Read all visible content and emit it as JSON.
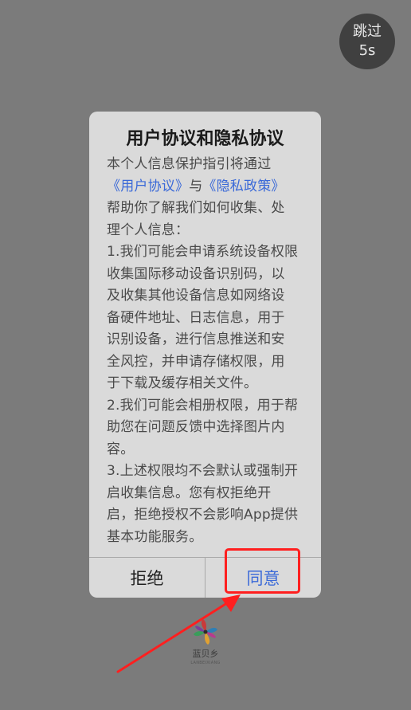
{
  "skip": {
    "label": "跳过",
    "countdown": "5s"
  },
  "dialog": {
    "title": "用户协议和隐私协议",
    "intro_1": "本个人信息保护指引将通过",
    "link_user_agreement": "《用户协议》",
    "connector": "与",
    "link_privacy_policy": "《隐私政策》",
    "intro_2": "帮助你了解我们如何收集、处",
    "intro_3": "理个人信息：",
    "lines": [
      "1.我们可能会申请系统设备权限",
      "收集国际移动设备识别码，以",
      "及收集其他设备信息如网络设",
      "备硬件地址、日志信息，用于",
      "识别设备，进行信息推送和安",
      "全风控，并申请存储权限，用",
      "于下载及缓存相关文件。",
      "2.我们可能会相册权限，用于帮",
      "助您在问题反馈中选择图片内",
      "容。",
      "3.上述权限均不会默认或强制开",
      "启收集信息。您有权拒绝开",
      "启，拒绝授权不会影响App提供",
      "基本功能服务。"
    ],
    "reject_label": "拒绝",
    "agree_label": "同意"
  },
  "logo": {
    "name": "蓝贝乡",
    "subtitle": "LANBEIXIANG"
  },
  "colors": {
    "overlay": "#7b7b7b",
    "dialog_bg": "#dadada",
    "link": "#3a69d8",
    "annotation": "#ff1f1f"
  }
}
